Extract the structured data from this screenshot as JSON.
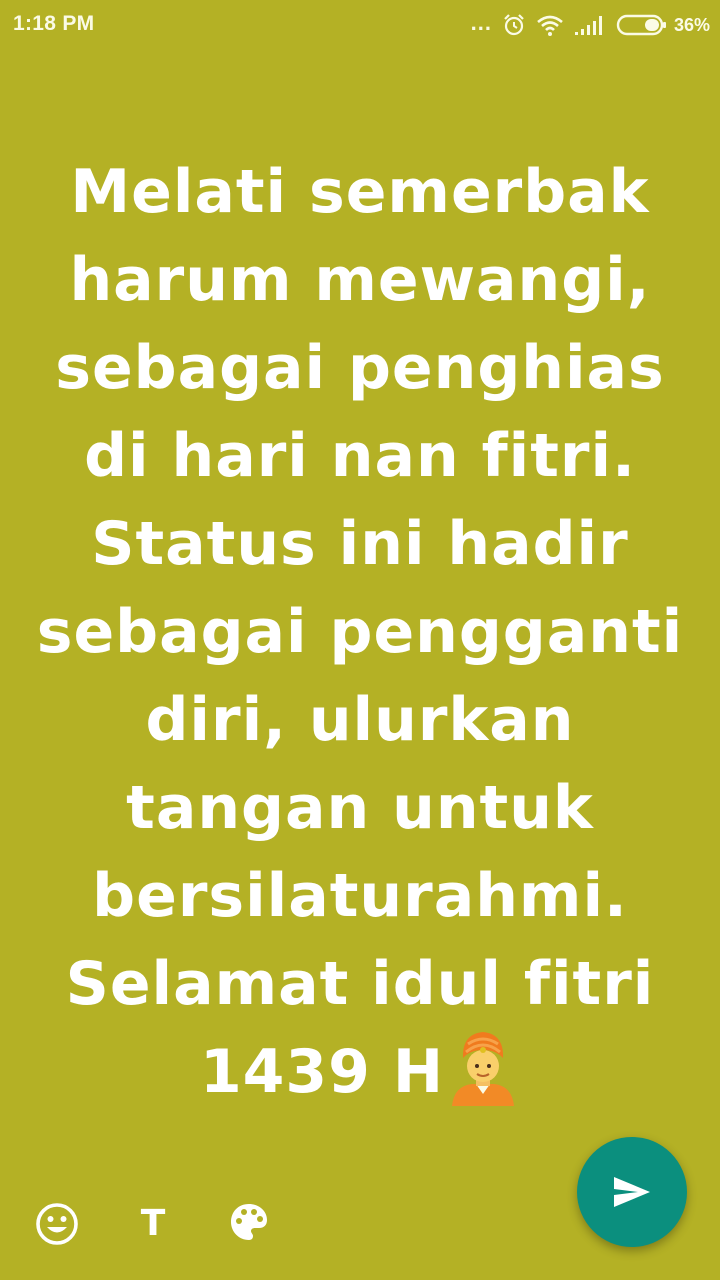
{
  "theme": {
    "background": "#b4b125",
    "fab_color": "#0b8f7e",
    "text_color": "#ffffff"
  },
  "status_bar": {
    "time": "1:18 PM",
    "dots": "...",
    "battery_percent": "36%",
    "icons": [
      "alarm-icon",
      "wifi-icon",
      "signal-icon",
      "battery-icon"
    ]
  },
  "status": {
    "text": "Melati semerbak\nharum mewangi,\nsebagai penghias\ndi hari nan fitri.\nStatus ini hadir\nsebagai pengganti\ndiri, ulurkan\ntangan untuk\nbersilaturahmi.\nSelamat idul fitri\n1439 H",
    "trailing_emoji": "person-with-turban-emoji"
  },
  "toolbar": {
    "text_tool_label": "T",
    "icons": [
      "smiley-icon",
      "text-icon",
      "palette-icon"
    ]
  },
  "send_button": {
    "icon": "send-icon"
  }
}
